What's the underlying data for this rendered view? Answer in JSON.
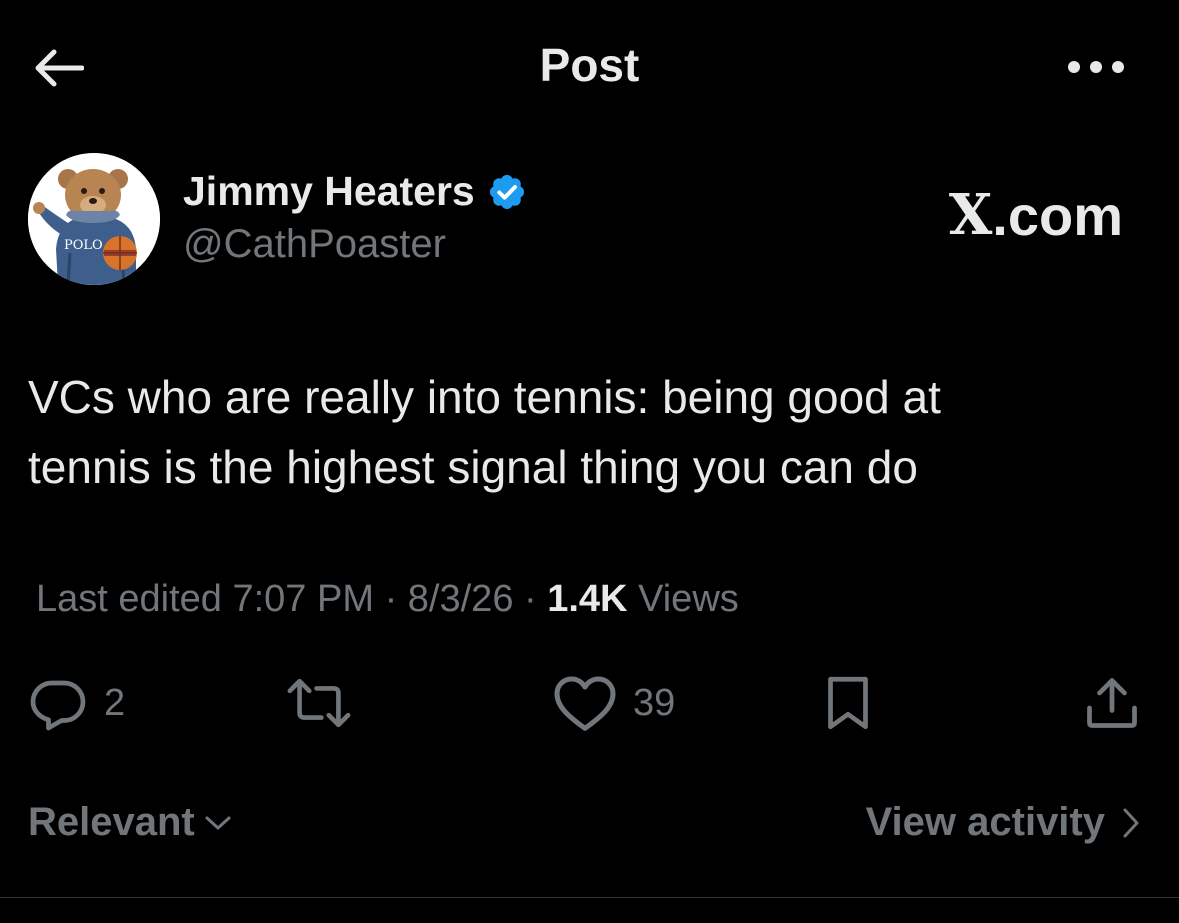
{
  "header": {
    "title": "Post",
    "back_icon": "arrow-left-icon",
    "more_icon": "more-horizontal-icon"
  },
  "author": {
    "display_name": "Jimmy Heaters",
    "handle": "@CathPoaster",
    "verified": true,
    "verified_badge_color": "#1d9bf0",
    "avatar_icon": "polo-bear-avatar"
  },
  "watermark": {
    "logo_letter": "X",
    "suffix": ".com"
  },
  "post": {
    "lines": [
      "VCs who are really into tennis: being good at",
      "tennis is the highest signal thing you can do"
    ]
  },
  "meta": {
    "edited_prefix": "Last edited",
    "time": "7:07 PM",
    "separator": "·",
    "date": "8/3/26",
    "views_count": "1.4K",
    "views_label": "Views"
  },
  "actions": {
    "reply": {
      "icon": "reply-icon",
      "count": "2"
    },
    "repost": {
      "icon": "repost-icon",
      "count": ""
    },
    "like": {
      "icon": "heart-icon",
      "count": "39"
    },
    "bookmark": {
      "icon": "bookmark-icon"
    },
    "share": {
      "icon": "share-icon"
    }
  },
  "footer": {
    "sort_label": "Relevant",
    "activity_label": "View activity"
  },
  "colors": {
    "background": "#000000",
    "primary_text": "#e7e9ea",
    "secondary_text": "#71767b",
    "accent": "#1d9bf0"
  }
}
